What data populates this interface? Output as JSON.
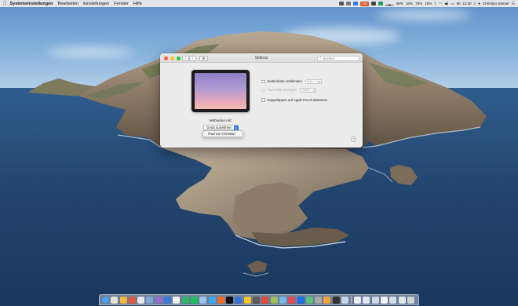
{
  "menubar": {
    "app_name": "Systemeinstellungen",
    "menus": [
      "Bearbeiten",
      "Einstellungen",
      "Fenster",
      "Hilfe"
    ],
    "status": {
      "pill_value": "13K",
      "percent_a": "39%",
      "percent_b": "16%",
      "percent_c": "76%",
      "percent_d": "18%",
      "clock": "Mi. 12:30",
      "user": "Christian Steiner"
    }
  },
  "window": {
    "title": "Sidecar",
    "search_placeholder": "Suchen",
    "connect_label": "Verbinden mit:",
    "device_select": "Gerät auswählen",
    "device_option": "iPad von Christian",
    "options": [
      {
        "label": "Seitenleiste einblenden",
        "select": "links",
        "enabled": true
      },
      {
        "label": "Touch Bar anzeigen",
        "select": "unten",
        "enabled": false
      },
      {
        "label": "Doppeltippen auf Apple Pencil aktivieren",
        "enabled": true
      }
    ],
    "help": "?"
  },
  "colors": {
    "accent": "#2f7cf6",
    "close": "#fe5f57",
    "minimize": "#febc2e",
    "zoom": "#28c840"
  },
  "dock": {
    "app_colors": [
      "#4aa3f0",
      "#e9e3d4",
      "#f2b63b",
      "#d85a41",
      "#e8e8e8",
      "#7ea4d8",
      "#9a6bd6",
      "#3b7ad8",
      "#f5f5f5",
      "#2fb46b",
      "#1ec05a",
      "#9cc4f0",
      "#3aa7ef",
      "#f06b2c",
      "#111111",
      "#3274e8",
      "#f4c42d",
      "#5b5b5b",
      "#e24a3a",
      "#9fbe5a",
      "#78b8e8",
      "#e14b5a",
      "#1f6fe5",
      "#59c37d",
      "#aaaaaa",
      "#f0a53a",
      "#333333",
      "#c9d7e8"
    ],
    "doc_colors": [
      "#e9eef5",
      "#dfe6ef",
      "#cfd9e6",
      "#eef1f5",
      "#d5dde8",
      "#e3e8ef"
    ],
    "trash": "#cfd3d8"
  }
}
